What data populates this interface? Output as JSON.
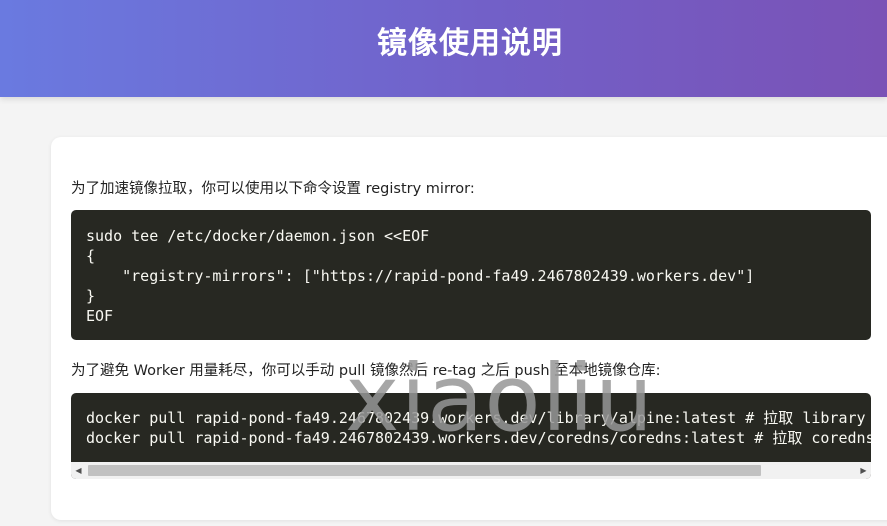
{
  "header": {
    "title": "镜像使用说明"
  },
  "content": {
    "para1": "为了加速镜像拉取，你可以使用以下命令设置 registry mirror:",
    "code1": "sudo tee /etc/docker/daemon.json <<EOF\n{\n    \"registry-mirrors\": [\"https://rapid-pond-fa49.2467802439.workers.dev\"]\n}\nEOF",
    "para2": "为了避免 Worker 用量耗尽，你可以手动 pull 镜像然后 re-tag 之后 push 至本地镜像仓库:",
    "code2": "docker pull rapid-pond-fa49.2467802439.workers.dev/library/alpine:latest # 拉取 library 镜像\ndocker pull rapid-pond-fa49.2467802439.workers.dev/coredns/coredns:latest # 拉取 coredns 镜像"
  },
  "scrollbar": {
    "left_arrow": "◀",
    "right_arrow": "▶"
  },
  "watermark": {
    "text": "xiaoliu"
  },
  "colors": {
    "header_gradient_start": "#6a7ae0",
    "header_gradient_end": "#7a52b6",
    "code_background": "#272822",
    "code_text": "#f8f8f2"
  }
}
